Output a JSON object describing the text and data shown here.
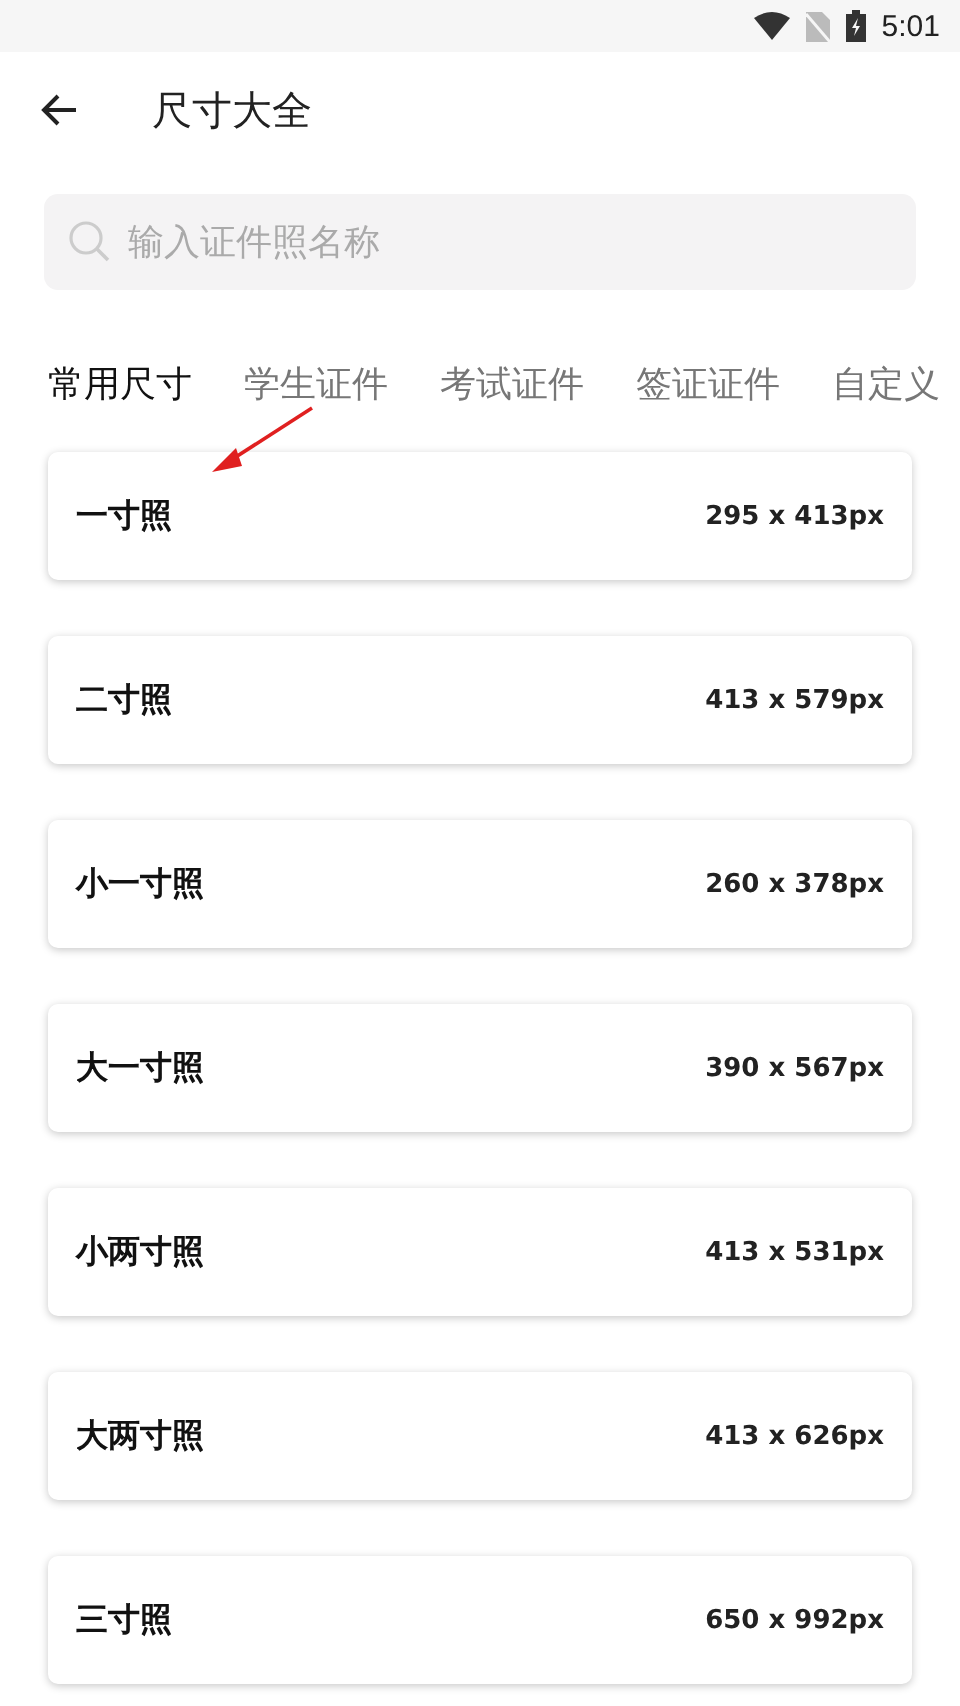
{
  "status_bar": {
    "time": "5:01"
  },
  "header": {
    "title": "尺寸大全"
  },
  "search": {
    "placeholder": "输入证件照名称"
  },
  "tabs": [
    {
      "label": "常用尺寸",
      "selected": true
    },
    {
      "label": "学生证件",
      "selected": false
    },
    {
      "label": "考试证件",
      "selected": false
    },
    {
      "label": "签证证件",
      "selected": false
    },
    {
      "label": "自定义",
      "selected": false
    }
  ],
  "sizes": [
    {
      "name": "一寸照",
      "size": "295 x 413px"
    },
    {
      "name": "二寸照",
      "size": "413 x 579px"
    },
    {
      "name": "小一寸照",
      "size": "260 x 378px"
    },
    {
      "name": "大一寸照",
      "size": "390 x 567px"
    },
    {
      "name": "小两寸照",
      "size": "413 x 531px"
    },
    {
      "name": "大两寸照",
      "size": "413 x 626px"
    },
    {
      "name": "三寸照",
      "size": "650 x 992px"
    }
  ]
}
